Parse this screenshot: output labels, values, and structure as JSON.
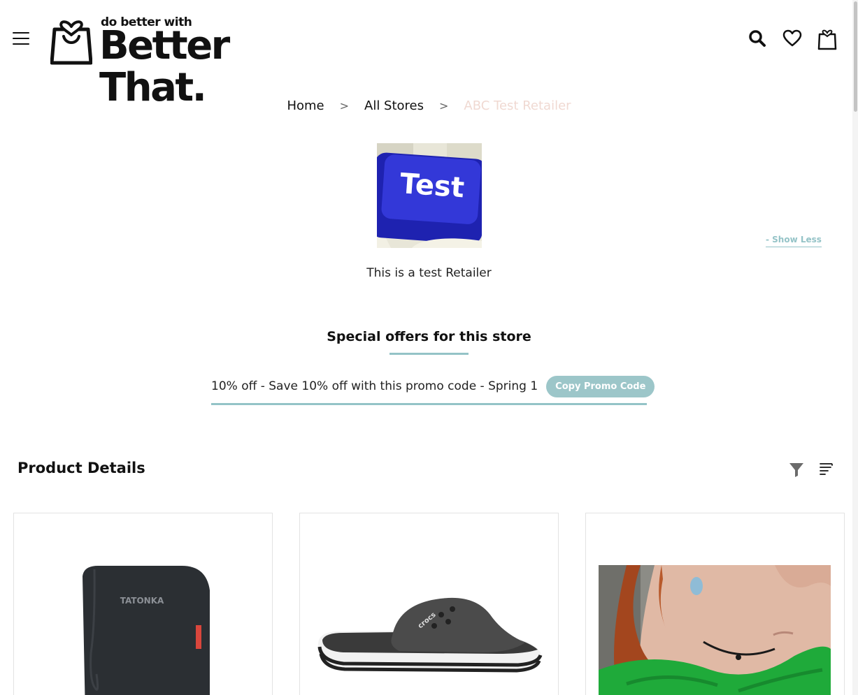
{
  "header": {
    "logo_tagline": "do better with",
    "logo_name": "Better That.",
    "icons": [
      "menu-icon",
      "search-icon",
      "heart-icon",
      "shopping-bag-icon"
    ]
  },
  "breadcrumb": {
    "home": "Home",
    "stores": "All Stores",
    "current": "ABC Test Retailer"
  },
  "store": {
    "logo_text": "Test",
    "show_less": "- Show Less",
    "description": "This is a test Retailer"
  },
  "offers": {
    "title": "Special offers for this store",
    "promo_text": "10% off - Save 10% off with this promo code - Spring 1",
    "copy_button": "Copy Promo Code"
  },
  "products": {
    "title": "Product Details",
    "filter_icon": "filter-icon",
    "sort_icon": "sort-icon",
    "items": [
      {
        "image": "travel-wallet-image",
        "brand_text": "TATONKA"
      },
      {
        "image": "slide-sandal-image",
        "brand_text": "crocs"
      },
      {
        "image": "choker-necklace-model-image"
      }
    ]
  },
  "colors": {
    "accent": "#94c3c7",
    "button": "#9cc6c9",
    "breadcrumb_current": "#f0d9d2"
  }
}
